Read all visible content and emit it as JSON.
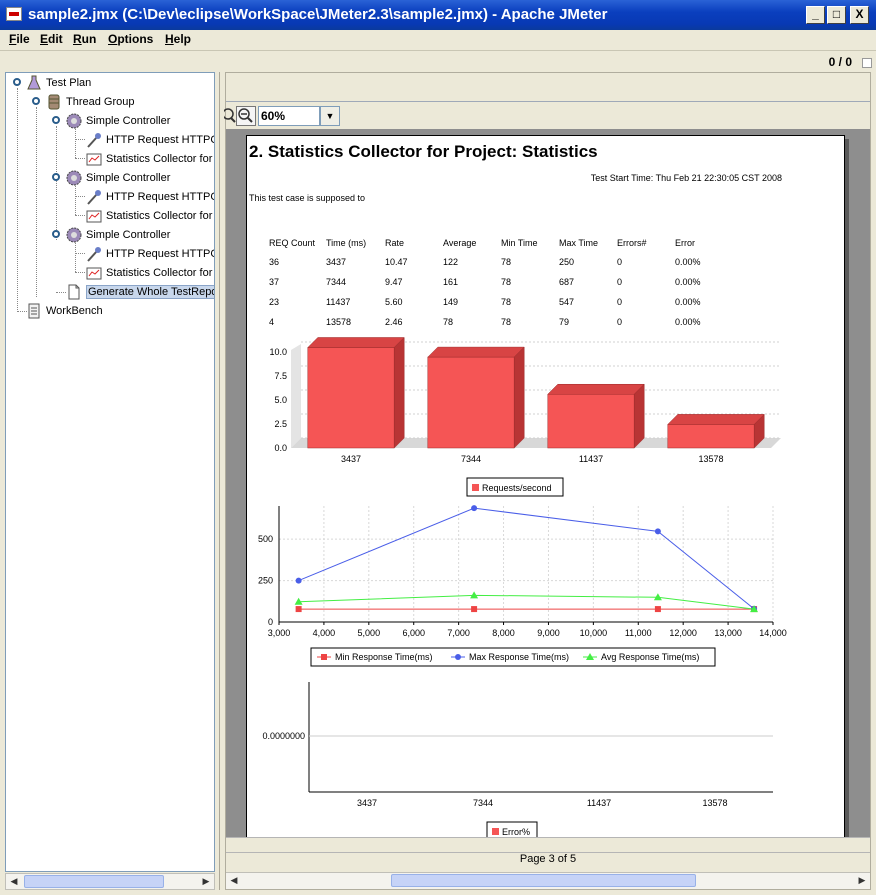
{
  "window": {
    "title": "sample2.jmx (C:\\Dev\\eclipse\\WorkSpace\\JMeter2.3\\sample2.jmx) - Apache JMeter",
    "minimize": "_",
    "maximize": "□",
    "close": "X"
  },
  "menu": [
    "File",
    "Edit",
    "Run",
    "Options",
    "Help"
  ],
  "toolbar": {
    "counter": "0 / 0"
  },
  "tree": {
    "items": [
      {
        "label": "Test Plan",
        "icon": "test-plan-icon"
      },
      {
        "label": "Thread Group",
        "icon": "thread-group-icon"
      },
      {
        "label": "Simple Controller",
        "icon": "controller-icon"
      },
      {
        "label": "HTTP Request HTTPCl",
        "icon": "sampler-icon"
      },
      {
        "label": "Statistics Collector for",
        "icon": "listener-icon"
      },
      {
        "label": "Simple Controller",
        "icon": "controller-icon"
      },
      {
        "label": "HTTP Request HTTPCl",
        "icon": "sampler-icon"
      },
      {
        "label": "Statistics Collector for",
        "icon": "listener-icon"
      },
      {
        "label": "Simple Controller",
        "icon": "controller-icon"
      },
      {
        "label": "HTTP Request HTTPCl",
        "icon": "sampler-icon"
      },
      {
        "label": "Statistics Collector for",
        "icon": "listener-icon"
      },
      {
        "label": "Generate Whole TestRepo",
        "icon": "document-icon"
      },
      {
        "label": "WorkBench",
        "icon": "workbench-icon"
      }
    ]
  },
  "zoom": {
    "value": "60%"
  },
  "report": {
    "title": "2. Statistics Collector for Project: Statistics",
    "start_time": "Test Start Time: Thu Feb 21 22:30:05 CST 2008",
    "description": "This test case is supposed to",
    "table": {
      "headers": [
        "REQ Count",
        "Time (ms)",
        "Rate",
        "Average",
        "Min Time",
        "Max Time",
        "Errors#",
        "Error"
      ],
      "rows": [
        [
          "36",
          "3437",
          "10.47",
          "122",
          "78",
          "250",
          "0",
          "0.00%"
        ],
        [
          "37",
          "7344",
          "9.47",
          "161",
          "78",
          "687",
          "0",
          "0.00%"
        ],
        [
          "23",
          "11437",
          "5.60",
          "149",
          "78",
          "547",
          "0",
          "0.00%"
        ],
        [
          "4",
          "13578",
          "2.46",
          "78",
          "78",
          "79",
          "0",
          "0.00%"
        ]
      ]
    }
  },
  "chart_data": [
    {
      "type": "bar",
      "categories": [
        "3437",
        "7344",
        "11437",
        "13578"
      ],
      "values": [
        10.47,
        9.47,
        5.6,
        2.46
      ],
      "yticks": [
        "0.0",
        "2.5",
        "5.0",
        "7.5",
        "10.0"
      ],
      "ylim": [
        0,
        10.5
      ],
      "series": [
        {
          "name": "Requests/second",
          "color": "#f55555"
        }
      ],
      "legend_position": "bottom",
      "grid": true
    },
    {
      "type": "line",
      "x": [
        3437,
        7344,
        11437,
        13578
      ],
      "xticks": [
        "3,000",
        "4,000",
        "5,000",
        "6,000",
        "7,000",
        "8,000",
        "9,000",
        "10,000",
        "11,000",
        "12,000",
        "13,000",
        "14,000"
      ],
      "xlim": [
        3000,
        14000
      ],
      "yticks": [
        "0",
        "250",
        "500"
      ],
      "ylim": [
        0,
        700
      ],
      "series": [
        {
          "name": "Min Response Time(ms)",
          "values": [
            78,
            78,
            78,
            78
          ],
          "color": "#ee4444",
          "marker": "square"
        },
        {
          "name": "Max Response Time(ms)",
          "values": [
            250,
            687,
            547,
            79
          ],
          "color": "#4a5ee8",
          "marker": "circle"
        },
        {
          "name": "Avg Response Time(ms)",
          "values": [
            122,
            161,
            149,
            78
          ],
          "color": "#44ee44",
          "marker": "triangle"
        }
      ],
      "legend_position": "bottom",
      "grid": true
    },
    {
      "type": "bar",
      "categories": [
        "3437",
        "7344",
        "11437",
        "13578"
      ],
      "values": [
        0,
        0,
        0,
        0
      ],
      "yticks": [
        "0.0000000"
      ],
      "series": [
        {
          "name": "Error%",
          "color": "#f55555"
        }
      ],
      "legend_position": "bottom"
    }
  ],
  "footer": {
    "page_label": "Page 3 of 5"
  }
}
